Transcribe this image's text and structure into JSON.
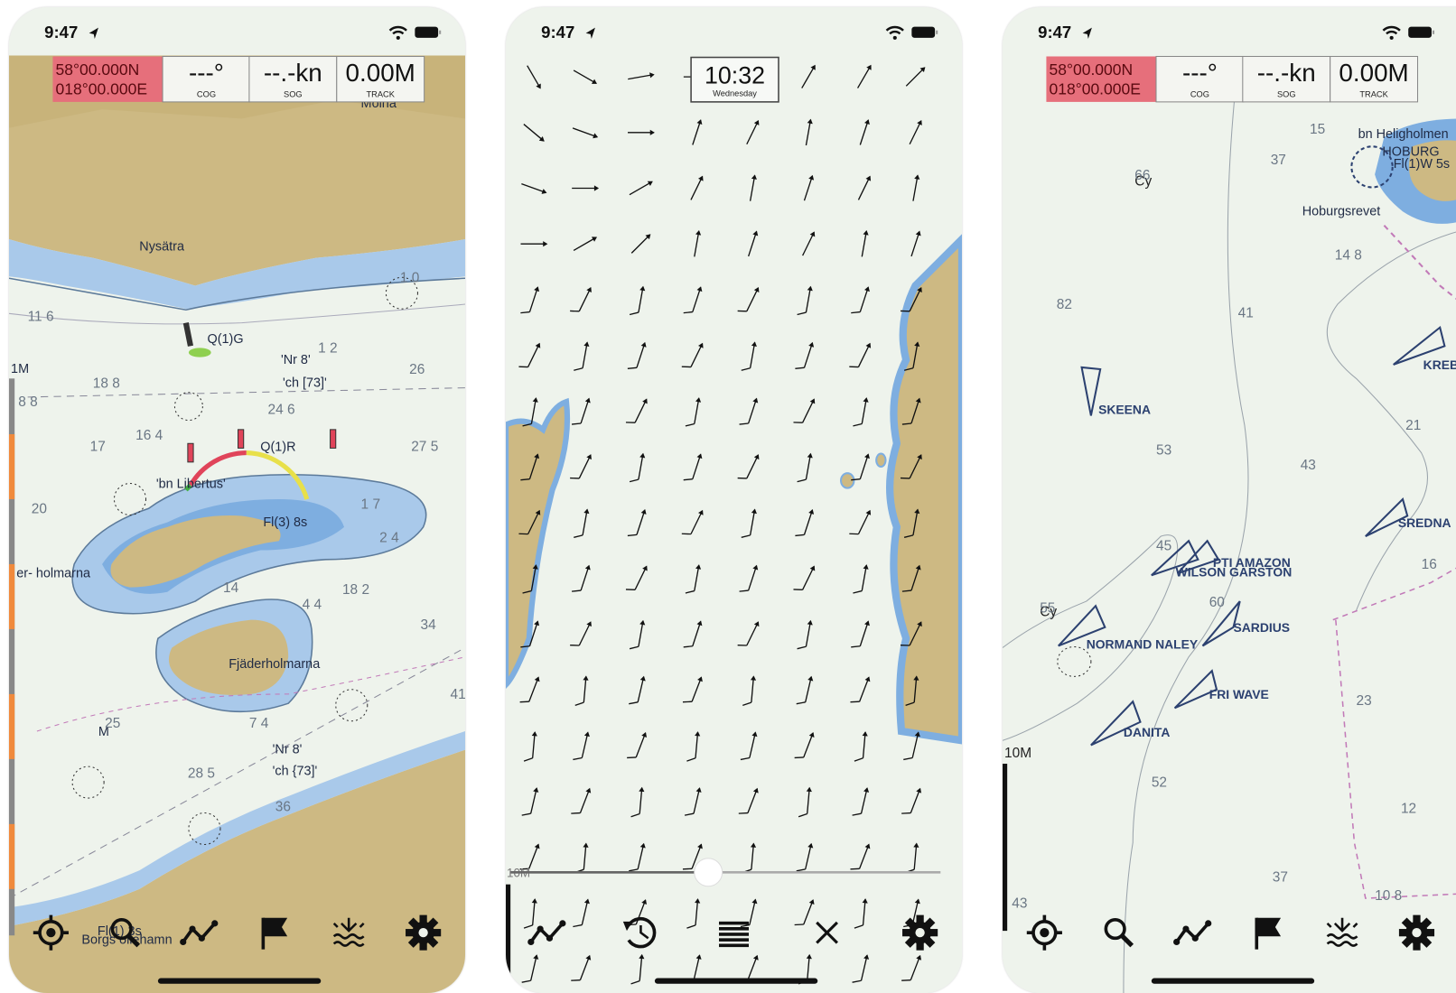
{
  "status_bar": {
    "time": "9:47"
  },
  "info_bar": {
    "lat": "58°00.000N",
    "lon": "018°00.000E",
    "cog_value": "---°",
    "cog_label": "COG",
    "sog_value": "--.-kn",
    "sog_label": "SOG",
    "track_value": "0.00M",
    "track_label": "TRACK"
  },
  "colors": {
    "land": "#cdb983",
    "shallow": "#a9c9ea",
    "deep_shallow": "#7eaee0",
    "water": "#eef3ec",
    "position_bg": "#e66f7b",
    "route": "#c27ab8"
  },
  "screen1": {
    "labels": [
      "Nysätra",
      "Q(1)G",
      "'Nr 8'",
      "'ch [73]'",
      "1M",
      "Q(1)R",
      "'bn Libertus'",
      "Fl(3) 8s",
      "er- holmarna",
      "Fjäderholmarna",
      "'Nr 8'",
      "'ch {73]'",
      "M",
      "Fl(1) 3s",
      "Borgs ollehamn",
      "Molna"
    ],
    "depths": [
      "11 6",
      "18 8",
      "8 8",
      "17",
      "16 4",
      "26",
      "27 5",
      "24 6",
      "1 7",
      "2 4",
      "18 2",
      "34",
      "41",
      "25",
      "28 5",
      "36",
      "1 0",
      "20",
      "4 4",
      "14",
      "7 4",
      "1 2"
    ],
    "toolbar": [
      "locate-icon",
      "search-icon",
      "track-icon",
      "flag-icon",
      "tide-icon",
      "settings-icon"
    ]
  },
  "screen2": {
    "time_box": {
      "time": "10:32",
      "day": "Wednesday"
    },
    "scale_label": "10M",
    "time_slider_position": 0.46,
    "toolbar": [
      "track-icon",
      "history-icon",
      "list-icon",
      "close-icon",
      "settings-icon"
    ]
  },
  "screen3": {
    "labels": [
      "bn Heligholmen",
      "HOBURG",
      "Fl(1)W 5s",
      "Hoburgsrevet",
      "Cy",
      "Cy",
      "10M"
    ],
    "vessels": [
      "SKEENA",
      "PTI AMAZON",
      "WILSON GARSTON",
      "SARDIUS",
      "NORMAND NALEY",
      "FRI WAVE",
      "DANITA",
      "SREDNA",
      "KREB"
    ],
    "depths": [
      "15",
      "37",
      "66",
      "14 8",
      "82",
      "41",
      "21",
      "53",
      "43",
      "45",
      "60",
      "55",
      "23",
      "52",
      "12",
      "37",
      "43",
      "10 8",
      "16"
    ],
    "toolbar": [
      "locate-icon",
      "search-icon",
      "track-icon",
      "flag-icon",
      "tide-icon",
      "settings-icon"
    ]
  }
}
